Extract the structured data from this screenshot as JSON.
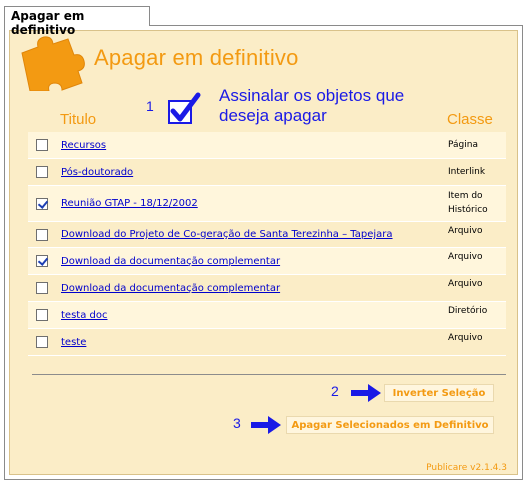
{
  "tab": {
    "label": "Apagar em definitivo"
  },
  "header": {
    "title": "Apagar em definitivo",
    "hint": "Assinalar os objetos que deseja apagar"
  },
  "steps": {
    "one": "1",
    "two": "2",
    "three": "3"
  },
  "columns": {
    "title": "Titulo",
    "class": "Classe"
  },
  "items": [
    {
      "title": "Recursos",
      "class": "Página",
      "checked": false
    },
    {
      "title": "Pós-doutorado",
      "class": "Interlink",
      "checked": false
    },
    {
      "title": "Reunião GTAP - 18/12/2002",
      "class": "Item do Histórico",
      "checked": true
    },
    {
      "title": "Download do Projeto de Co-geração de Santa Terezinha – Tapejara",
      "class": "Arquivo",
      "checked": false
    },
    {
      "title": "Download da documentação complementar",
      "class": "Arquivo",
      "checked": true
    },
    {
      "title": "Download da documentação complementar",
      "class": "Arquivo",
      "checked": false
    },
    {
      "title": "testa doc",
      "class": "Diretório",
      "checked": false
    },
    {
      "title": "teste",
      "class": "Arquivo",
      "checked": false
    }
  ],
  "buttons": {
    "invert": "Inverter Seleção",
    "delete": "Apagar Selecionados em Definitivo"
  },
  "footer": {
    "version": "Publicare v2.1.4.3"
  },
  "colors": {
    "accent": "#f39a12",
    "panel": "#fbedc7",
    "link": "#0000cc",
    "instruction": "#1a1ae6"
  }
}
